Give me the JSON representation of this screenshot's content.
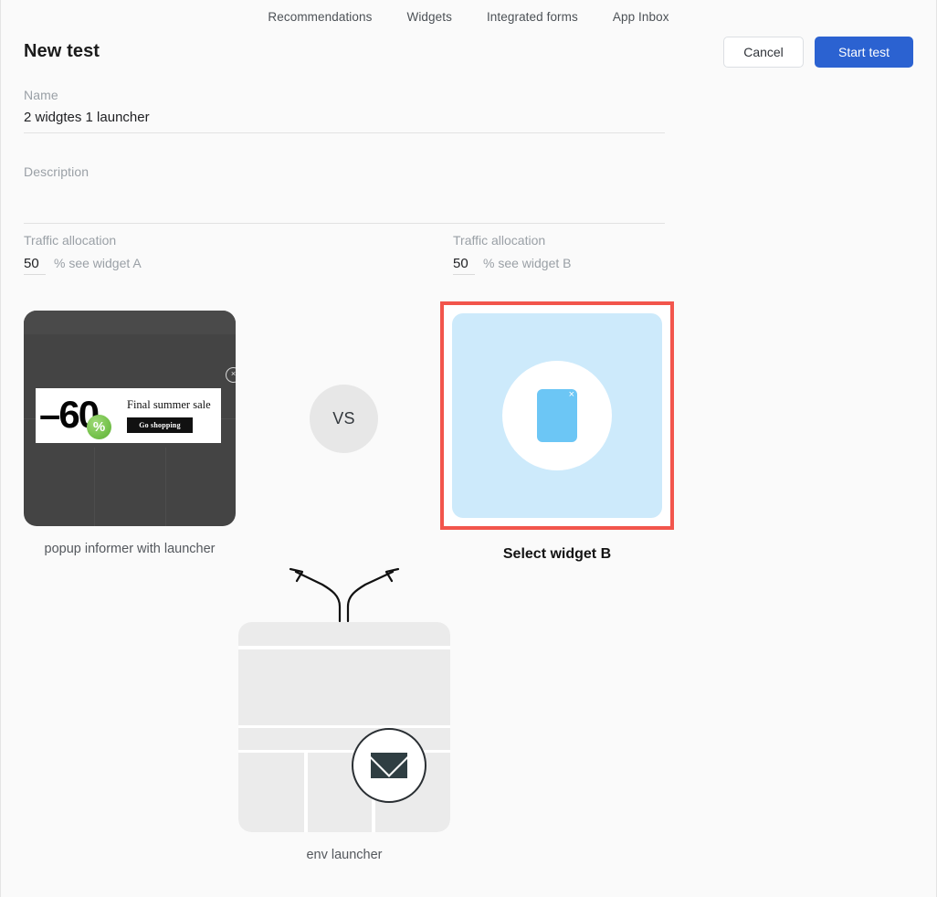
{
  "nav": {
    "items": [
      {
        "label": "Recommendations"
      },
      {
        "label": "Widgets"
      },
      {
        "label": "Integrated forms"
      },
      {
        "label": "App Inbox"
      }
    ]
  },
  "header": {
    "title": "New test",
    "cancel_label": "Cancel",
    "start_label": "Start test"
  },
  "form": {
    "name": {
      "label": "Name",
      "value": "2 widgtes 1 launcher",
      "placeholder": "Name"
    },
    "description": {
      "label": "Description",
      "value": "",
      "placeholder": "Description"
    },
    "traffic_a": {
      "label": "Traffic allocation",
      "value": "50",
      "suffix": "% see widget A"
    },
    "traffic_b": {
      "label": "Traffic allocation",
      "value": "50",
      "suffix": "% see widget B"
    }
  },
  "widget_a": {
    "caption": "popup informer with launcher",
    "close_glyph": "×",
    "promo": {
      "discount": "–60",
      "percent": "%",
      "headline": "Final summer sale",
      "cta": "Go shopping"
    }
  },
  "vs": {
    "label": "VS"
  },
  "widget_b": {
    "caption": "Select widget B",
    "close_glyph": "×",
    "selected": true,
    "selection_color": "#f2554c",
    "card_color": "#cdeafb",
    "accent_color": "#6cc6f5"
  },
  "launcher": {
    "caption": "env launcher",
    "icon": "envelope-icon"
  },
  "colors": {
    "primary_button": "#2b62d1",
    "page_background": "#fafafa",
    "muted_text": "#9aa0a6",
    "dark_card": "#444444"
  }
}
